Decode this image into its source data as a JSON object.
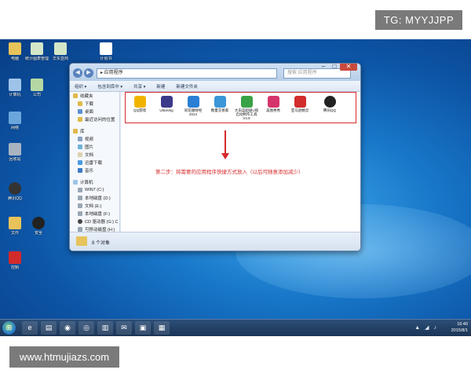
{
  "watermarks": {
    "top": "TG: MYYJJPP",
    "bottom": "www.htmujiazs.com"
  },
  "desktop_icons": [
    {
      "label": "电脑",
      "color": "#e7c35a",
      "icon": "computer-icon"
    },
    {
      "label": "统计图表管理",
      "color": "#d4e6c8",
      "icon": "document-icon"
    },
    {
      "label": "华东亚商",
      "color": "#d4e6c8",
      "icon": "document-icon"
    },
    {
      "label": "计划书",
      "color": "#ffffff",
      "icon": "document-icon"
    },
    {
      "label": "计算机",
      "color": "#9fc3e8",
      "icon": "computer-icon"
    },
    {
      "label": "公司",
      "color": "#b5d8a3",
      "icon": "document-icon"
    },
    {
      "label": "网络",
      "color": "#6aa6dc",
      "icon": "network-icon"
    },
    {
      "label": "回收站",
      "color": "#aab4c0",
      "icon": "recycle-bin-icon"
    },
    {
      "label": "腾讯QQ",
      "color": "#333333",
      "icon": "qq-icon"
    },
    {
      "label": "文件",
      "color": "#e7c35a",
      "icon": "folder-icon"
    },
    {
      "label": "安全",
      "color": "#222222",
      "icon": "app-icon"
    },
    {
      "label": "控制",
      "color": "#d22b2b",
      "icon": "app-icon"
    }
  ],
  "window": {
    "address": "▸ 应用程序",
    "search_placeholder": "搜索 应用程序",
    "toolbar": [
      "组织 ▾",
      "包含到库中 ▾",
      "共享 ▾",
      "新建",
      "新建文件夹"
    ],
    "nav": [
      {
        "label": "收藏夹",
        "sub": false
      },
      {
        "label": "下载",
        "sub": true
      },
      {
        "label": "桌面",
        "sub": true
      },
      {
        "label": "最近访问的位置",
        "sub": true
      },
      {
        "gap": true
      },
      {
        "label": "库",
        "sub": false
      },
      {
        "label": "视频",
        "sub": true
      },
      {
        "label": "图片",
        "sub": true
      },
      {
        "label": "文档",
        "sub": true
      },
      {
        "label": "迅雷下载",
        "sub": true
      },
      {
        "label": "音乐",
        "sub": true
      },
      {
        "gap": true
      },
      {
        "label": "计算机",
        "sub": false
      },
      {
        "label": "WIN7 (C:)",
        "sub": true
      },
      {
        "label": "本地磁盘 (D:)",
        "sub": true
      },
      {
        "label": "文档 (E:)",
        "sub": true
      },
      {
        "label": "本地磁盘 (F:)",
        "sub": true
      },
      {
        "label": "CD 驱动器 (G:) C",
        "sub": true
      },
      {
        "label": "可移动磁盘 (H:)",
        "sub": true
      }
    ],
    "apps": [
      {
        "label": "QQ游戏",
        "color": "#f0b400"
      },
      {
        "label": "UltraVeg",
        "color": "#3a3a8a"
      },
      {
        "label": "同花顺财经2014",
        "color": "#2a7fd4"
      },
      {
        "label": "数量交易家",
        "color": "#3c96d8"
      },
      {
        "label": "大白菜超级U盘启动制作工具V4.6",
        "color": "#3aa246"
      },
      {
        "label": "美图秀秀",
        "color": "#d6336c"
      },
      {
        "label": "亚马逊精灵",
        "color": "#d22b2b"
      },
      {
        "label": "腾讯QQ",
        "color": "#222222"
      }
    ],
    "note": "第二步：将需要的应用程序快捷方式放入（以后可随意添加减少）",
    "status": "8 个对象"
  },
  "taskbar": {
    "start": "⊞",
    "buttons": [
      "e",
      "▤",
      "◉",
      "◎",
      "▥",
      "✉",
      "▣",
      "▦"
    ],
    "time": "16:40",
    "date": "2015/8/1"
  }
}
